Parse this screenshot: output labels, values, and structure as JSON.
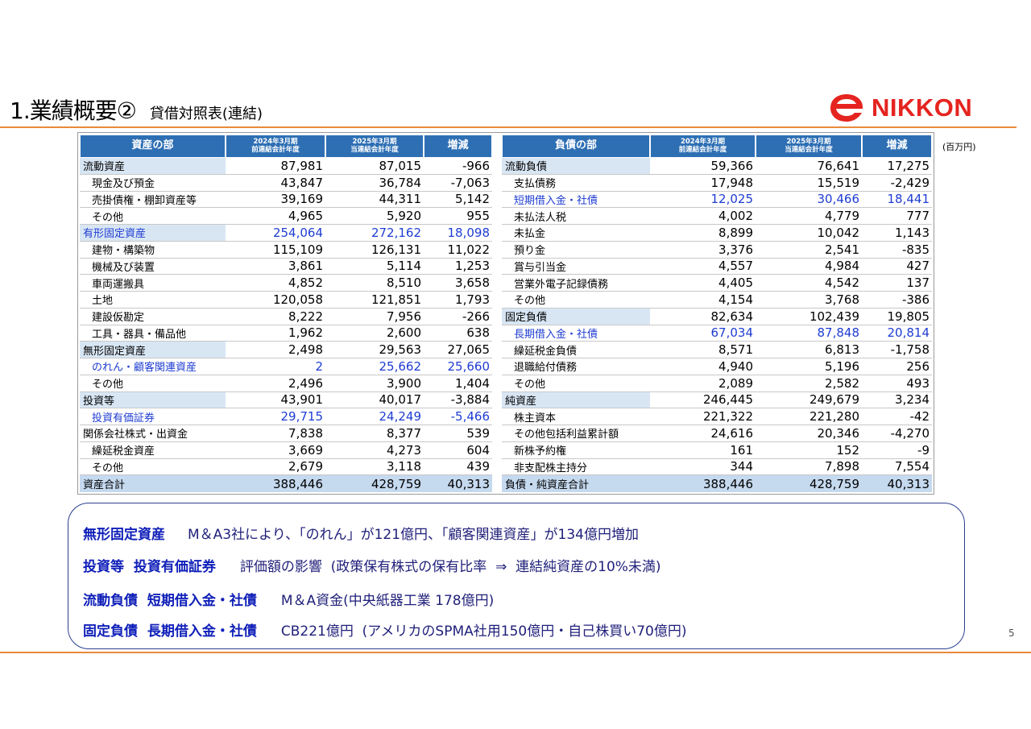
{
  "header": {
    "title": "1.業績概要②",
    "subtitle": "貸借対照表(連結)",
    "logo_text": "NIKKON",
    "brand_color": "#e52420"
  },
  "unit_label": "(百万円)",
  "page_number": "5",
  "assets": {
    "header": {
      "label": "資産の部",
      "prev_l1": "2024年3月期",
      "prev_l2": "前連結会計年度",
      "curr_l1": "2025年3月期",
      "curr_l2": "当連結会計年度",
      "diff": "増減"
    },
    "rows": [
      {
        "label": "流動資産",
        "prev": "87,981",
        "curr": "87,015",
        "diff": "-966",
        "type": "cat"
      },
      {
        "label": "現金及び預金",
        "prev": "43,847",
        "curr": "36,784",
        "diff": "-7,063",
        "type": "sub"
      },
      {
        "label": "売掛債権・棚卸資産等",
        "prev": "39,169",
        "curr": "44,311",
        "diff": "5,142",
        "type": "sub"
      },
      {
        "label": "その他",
        "prev": "4,965",
        "curr": "5,920",
        "diff": "955",
        "type": "sub"
      },
      {
        "label": "有形固定資産",
        "prev": "254,064",
        "curr": "272,162",
        "diff": "18,098",
        "type": "cat-blue"
      },
      {
        "label": "建物・構築物",
        "prev": "115,109",
        "curr": "126,131",
        "diff": "11,022",
        "type": "sub"
      },
      {
        "label": "機械及び装置",
        "prev": "3,861",
        "curr": "5,114",
        "diff": "1,253",
        "type": "sub"
      },
      {
        "label": "車両運搬具",
        "prev": "4,852",
        "curr": "8,510",
        "diff": "3,658",
        "type": "sub"
      },
      {
        "label": "土地",
        "prev": "120,058",
        "curr": "121,851",
        "diff": "1,793",
        "type": "sub"
      },
      {
        "label": "建設仮勘定",
        "prev": "8,222",
        "curr": "7,956",
        "diff": "-266",
        "type": "sub"
      },
      {
        "label": "工具・器具・備品他",
        "prev": "1,962",
        "curr": "2,600",
        "diff": "638",
        "type": "sub"
      },
      {
        "label": "無形固定資産",
        "prev": "2,498",
        "curr": "29,563",
        "diff": "27,065",
        "type": "cat"
      },
      {
        "label": "のれん・顧客関連資産",
        "prev": "2",
        "curr": "25,662",
        "diff": "25,660",
        "type": "sub-blue"
      },
      {
        "label": "その他",
        "prev": "2,496",
        "curr": "3,900",
        "diff": "1,404",
        "type": "sub"
      },
      {
        "label": "投資等",
        "prev": "43,901",
        "curr": "40,017",
        "diff": "-3,884",
        "type": "cat"
      },
      {
        "label": "投資有価証券",
        "prev": "29,715",
        "curr": "24,249",
        "diff": "-5,466",
        "type": "sub-blue"
      },
      {
        "label": "関係会社株式・出資金",
        "prev": "7,838",
        "curr": "8,377",
        "diff": "539",
        "type": "plain"
      },
      {
        "label": "繰延税金資産",
        "prev": "3,669",
        "curr": "4,273",
        "diff": "604",
        "type": "sub"
      },
      {
        "label": "その他",
        "prev": "2,679",
        "curr": "3,118",
        "diff": "439",
        "type": "sub"
      },
      {
        "label": "資産合計",
        "prev": "388,446",
        "curr": "428,759",
        "diff": "40,313",
        "type": "total"
      }
    ]
  },
  "liabilities": {
    "header": {
      "label": "負債の部",
      "prev_l1": "2024年3月期",
      "prev_l2": "前連結会計年度",
      "curr_l1": "2025年3月期",
      "curr_l2": "当連結会計年度",
      "diff": "増減"
    },
    "rows": [
      {
        "label": "流動負債",
        "prev": "59,366",
        "curr": "76,641",
        "diff": "17,275",
        "type": "cat"
      },
      {
        "label": "支払債務",
        "prev": "17,948",
        "curr": "15,519",
        "diff": "-2,429",
        "type": "sub"
      },
      {
        "label": "短期借入金・社債",
        "prev": "12,025",
        "curr": "30,466",
        "diff": "18,441",
        "type": "sub-blue"
      },
      {
        "label": "未払法人税",
        "prev": "4,002",
        "curr": "4,779",
        "diff": "777",
        "type": "sub"
      },
      {
        "label": "未払金",
        "prev": "8,899",
        "curr": "10,042",
        "diff": "1,143",
        "type": "sub"
      },
      {
        "label": "預り金",
        "prev": "3,376",
        "curr": "2,541",
        "diff": "-835",
        "type": "sub"
      },
      {
        "label": "賞与引当金",
        "prev": "4,557",
        "curr": "4,984",
        "diff": "427",
        "type": "sub"
      },
      {
        "label": "営業外電子記録債務",
        "prev": "4,405",
        "curr": "4,542",
        "diff": "137",
        "type": "sub"
      },
      {
        "label": "その他",
        "prev": "4,154",
        "curr": "3,768",
        "diff": "-386",
        "type": "sub"
      },
      {
        "label": "固定負債",
        "prev": "82,634",
        "curr": "102,439",
        "diff": "19,805",
        "type": "cat"
      },
      {
        "label": "長期借入金・社債",
        "prev": "67,034",
        "curr": "87,848",
        "diff": "20,814",
        "type": "sub-blue"
      },
      {
        "label": "繰延税金負債",
        "prev": "8,571",
        "curr": "6,813",
        "diff": "-1,758",
        "type": "sub"
      },
      {
        "label": "退職給付債務",
        "prev": "4,940",
        "curr": "5,196",
        "diff": "256",
        "type": "sub"
      },
      {
        "label": "その他",
        "prev": "2,089",
        "curr": "2,582",
        "diff": "493",
        "type": "sub"
      },
      {
        "label": "純資産",
        "prev": "246,445",
        "curr": "249,679",
        "diff": "3,234",
        "type": "cat"
      },
      {
        "label": "株主資本",
        "prev": "221,322",
        "curr": "221,280",
        "diff": "-42",
        "type": "sub"
      },
      {
        "label": "その他包括利益累計額",
        "prev": "24,616",
        "curr": "20,346",
        "diff": "-4,270",
        "type": "sub"
      },
      {
        "label": "新株予約権",
        "prev": "161",
        "curr": "152",
        "diff": "-9",
        "type": "sub"
      },
      {
        "label": "非支配株主持分",
        "prev": "344",
        "curr": "7,898",
        "diff": "7,554",
        "type": "sub"
      },
      {
        "label": "負債・純資産合計",
        "prev": "388,446",
        "curr": "428,759",
        "diff": "40,313",
        "type": "total"
      }
    ]
  },
  "notes": [
    {
      "key": "無形固定資産",
      "text": "M＆A3社により、「のれん」が121億円、「顧客関連資産」が134億円増加"
    },
    {
      "key": "投資等  投資有価証券",
      "text": "評価額の影響  (政策保有株式の保有比率  ⇒  連結純資産の10%未満)"
    },
    {
      "key": "流動負債  短期借入金・社債",
      "text": "M＆A資金(中央紙器工業 178億円)"
    },
    {
      "key": "固定負債  長期借入金・社債",
      "text": "CB221億円  (アメリカのSPMA社用150億円・自己株買い70億円)"
    }
  ]
}
